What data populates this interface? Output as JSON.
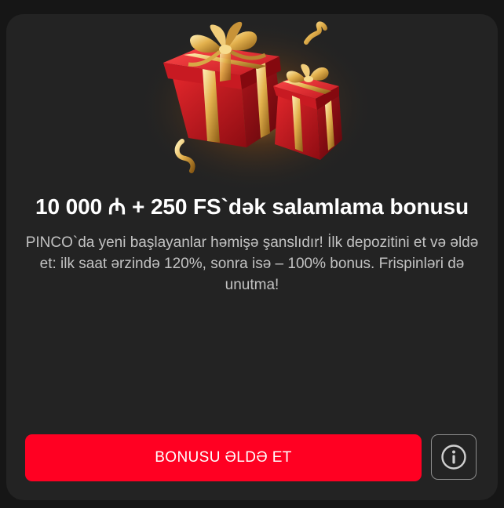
{
  "bonus": {
    "title": "10 000 ₼ + 250 FS`dək salamlama bonusu",
    "description": "PINCO`da yeni başlayanlar həmişə şanslıdır! İlk depozitini et və əldə et: ilk saat ərzində 120%, sonra isə – 100% bonus. Frispinləri də unutma!",
    "cta_label": "BONUSU ƏLDƏ ET",
    "info_icon": "info-icon",
    "image": "gift-boxes-illustration"
  },
  "colors": {
    "background": "#161616",
    "card": "#232323",
    "cta": "#ff0022",
    "text": "#ffffff",
    "muted_text": "#c3c3c3"
  }
}
